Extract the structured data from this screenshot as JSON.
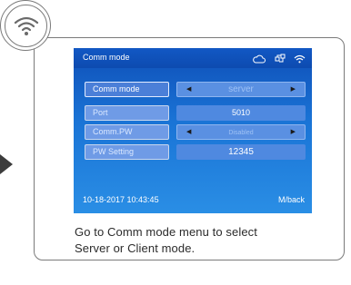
{
  "screen": {
    "title": "Comm mode",
    "rows": [
      {
        "label": "Comm mode",
        "value": "server"
      },
      {
        "label": "Port",
        "value": "5010"
      },
      {
        "label": "Comm.PW",
        "value": "Disabled"
      },
      {
        "label": "PW Setting",
        "value": "12345"
      }
    ],
    "datetime": "10-18-2017 10:43:45",
    "back_label": "M/back"
  },
  "caption": {
    "line1": "Go to Comm mode menu to select",
    "line2": "Server or Client mode."
  },
  "icons": {
    "badge": "wifi-icon",
    "status": [
      "cloud-icon",
      "network-icon",
      "wifi-icon"
    ]
  },
  "colors": {
    "screen_bg": "#1a74d6",
    "border": "#7a7a7a"
  }
}
